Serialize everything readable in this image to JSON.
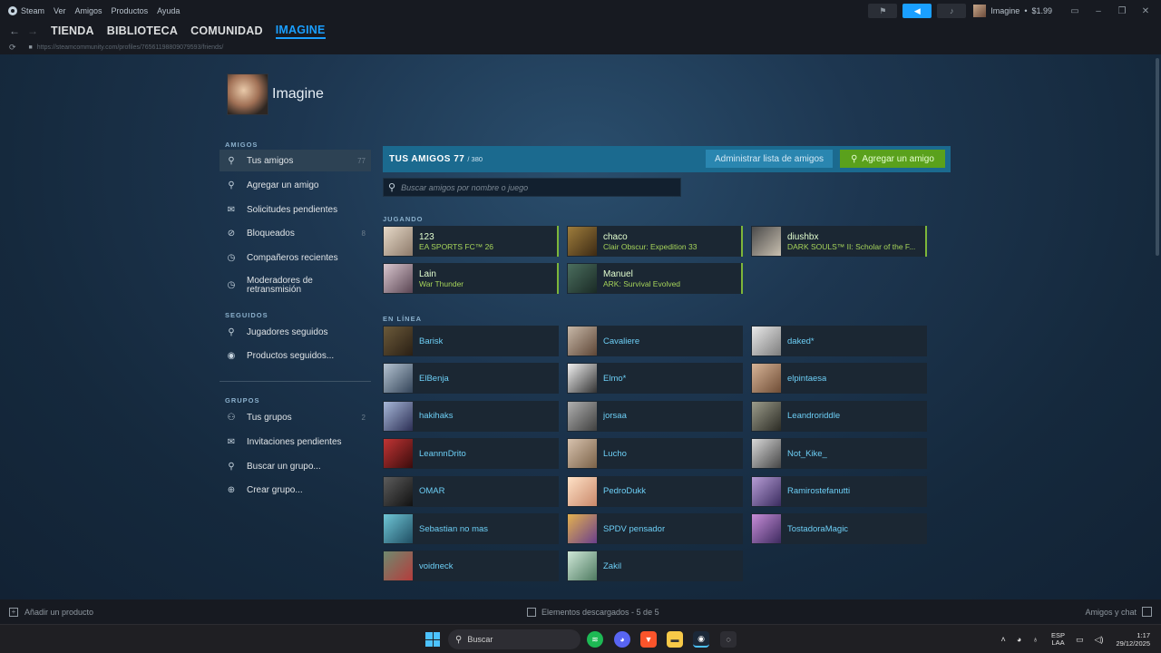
{
  "menubar": {
    "app": "Steam",
    "items": [
      "Ver",
      "Amigos",
      "Productos",
      "Ayuda"
    ],
    "account": "Imagine",
    "balance": "$1.99"
  },
  "nav": {
    "tabs": [
      "TIENDA",
      "BIBLIOTECA",
      "COMUNIDAD",
      "IMAGINE"
    ],
    "active_tab": "IMAGINE",
    "url": "https://steamcommunity.com/profiles/76561198809079593/friends/"
  },
  "profile": {
    "name": "Imagine"
  },
  "sidebar": {
    "amigos_title": "AMIGOS",
    "amigos": [
      {
        "label": "Tus amigos",
        "count": "77",
        "icon": "person-icon"
      },
      {
        "label": "Agregar un amigo",
        "count": "",
        "icon": "add-person-icon"
      },
      {
        "label": "Solicitudes pendientes",
        "count": "",
        "icon": "mail-icon"
      },
      {
        "label": "Bloqueados",
        "count": "8",
        "icon": "block-icon"
      },
      {
        "label": "Compañeros recientes",
        "count": "",
        "icon": "clock-icon"
      },
      {
        "label": "Moderadores de retransmisión",
        "count": "",
        "icon": "mod-clock-icon"
      }
    ],
    "seguidos_title": "SEGUIDOS",
    "seguidos": [
      {
        "label": "Jugadores seguidos",
        "icon": "follow-person-icon"
      },
      {
        "label": "Productos seguidos...",
        "icon": "follow-product-icon"
      }
    ],
    "grupos_title": "GRUPOS",
    "grupos": [
      {
        "label": "Tus grupos",
        "count": "2",
        "icon": "group-icon"
      },
      {
        "label": "Invitaciones pendientes",
        "count": "",
        "icon": "mail-icon"
      },
      {
        "label": "Buscar un grupo...",
        "count": "",
        "icon": "search-icon"
      },
      {
        "label": "Crear grupo...",
        "count": "",
        "icon": "plus-circle-icon"
      }
    ]
  },
  "friends": {
    "title": "TUS AMIGOS",
    "count": "77",
    "total": "/ 380",
    "manage_label": "Administrar lista de amigos",
    "add_label": "Agregar un amigo",
    "search_placeholder": "Buscar amigos por nombre o juego",
    "playing_title": "JUGANDO",
    "online_title": "EN LÍNEA",
    "playing": [
      {
        "name": "123",
        "game": "EA SPORTS FC™ 26"
      },
      {
        "name": "chaco",
        "game": "Clair Obscur: Expedition 33"
      },
      {
        "name": "diushbx",
        "game": "DARK SOULS™ II: Scholar of the F..."
      },
      {
        "name": "Lain",
        "game": "War Thunder"
      },
      {
        "name": "Manuel",
        "game": "ARK: Survival Evolved"
      }
    ],
    "online": [
      "Barisk",
      "Cavaliere",
      "daked*",
      "ElBenja",
      "Elmo*",
      "elpintaesa",
      "hakihaks",
      "jorsaa",
      "Leandroriddle",
      "LeannnDrito",
      "Lucho",
      "Not_Kike_",
      "OMAR",
      "PedroDukk",
      "Ramirostefanutti",
      "Sebastian no mas",
      "SPDV pensador",
      "TostadoraMagic",
      "voidneck",
      "Zakil"
    ]
  },
  "statusbar": {
    "add_product": "Añadir un producto",
    "downloads": "Elementos descargados - 5 de 5",
    "chat": "Amigos y chat"
  },
  "taskbar": {
    "search": "Buscar",
    "lang1": "ESP",
    "lang2": "LAA",
    "time": "1:17",
    "date": "29/12/2025"
  }
}
